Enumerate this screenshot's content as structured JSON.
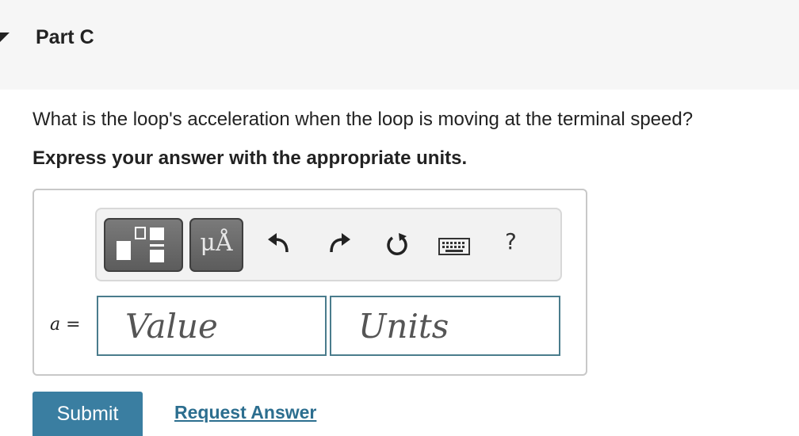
{
  "part": {
    "title": "Part C"
  },
  "question": {
    "text": "What is the loop's acceleration when the loop is moving at the terminal speed?",
    "instruction": "Express your answer with the appropriate units."
  },
  "toolbar": {
    "templates_icon": "templates-icon",
    "units_label": "μÅ",
    "undo_icon": "undo-icon",
    "redo_icon": "redo-icon",
    "reset_icon": "reset-icon",
    "keyboard_icon": "keyboard-icon",
    "help_label": "?"
  },
  "answer": {
    "variable": "a",
    "equals": " =",
    "value_placeholder": "Value",
    "units_placeholder": "Units"
  },
  "actions": {
    "submit_label": "Submit",
    "request_label": "Request Answer"
  },
  "colors": {
    "accent": "#3a7ea1",
    "link": "#2c6e8f",
    "field_border": "#4a7c8c"
  }
}
